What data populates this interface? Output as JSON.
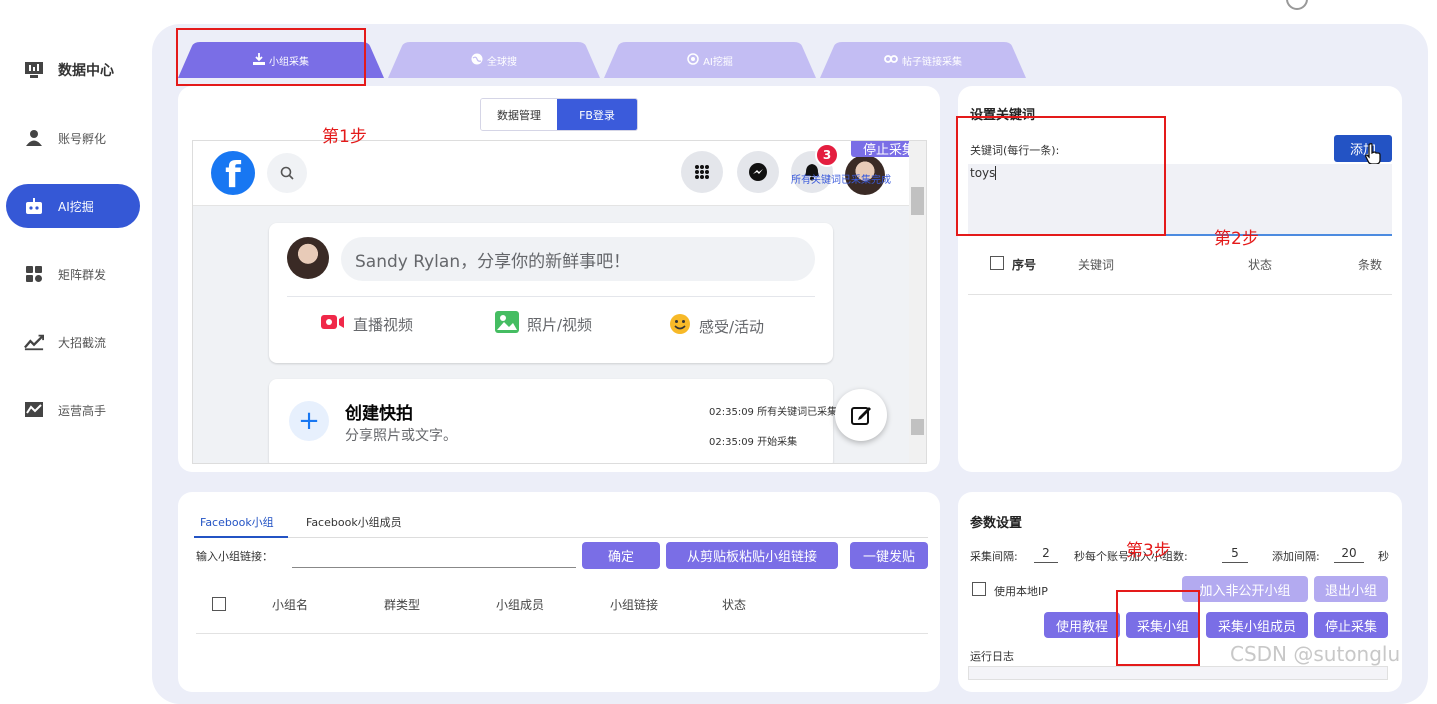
{
  "sidebar": {
    "items": [
      {
        "label": "数据中心",
        "icon": "data-center-icon"
      },
      {
        "label": "账号孵化",
        "icon": "user-icon"
      },
      {
        "label": "AI挖掘",
        "icon": "robot-icon"
      },
      {
        "label": "矩阵群发",
        "icon": "matrix-icon"
      },
      {
        "label": "大招截流",
        "icon": "trend-icon"
      },
      {
        "label": "运营高手",
        "icon": "chart-icon"
      }
    ]
  },
  "tabs": [
    {
      "label": "小组采集"
    },
    {
      "label": "全球搜"
    },
    {
      "label": "AI挖掘"
    },
    {
      "label": "帖子链接采集"
    }
  ],
  "browser": {
    "seg_buttons": [
      "数据管理",
      "FB登录"
    ],
    "stop_collect": "停止采集",
    "notif_count": "3",
    "overlay_status": "所有关键词已采集完成",
    "composer_placeholder": "Sandy Rylan，分享你的新鲜事吧！",
    "actions": [
      "直播视频",
      "照片/视频",
      "感受/活动"
    ],
    "story_title": "创建快拍",
    "story_sub": "分享照片或文字。",
    "log1": "02:35:09 所有关键词已采集完成",
    "log2": "02:35:09 开始采集"
  },
  "keywords": {
    "title": "设置关键词",
    "field_label": "关键词(每行一条):",
    "add_button": "添加",
    "value": "toys",
    "columns": [
      "序号",
      "关键词",
      "状态",
      "条数"
    ]
  },
  "groups": {
    "tabs": [
      "Facebook小组",
      "Facebook小组成员"
    ],
    "link_label": "输入小组链接：",
    "buttons": [
      "确定",
      "从剪贴板粘贴小组链接",
      "一键发贴"
    ],
    "columns": [
      "小组名",
      "群类型",
      "小组成员",
      "小组链接",
      "状态"
    ]
  },
  "params": {
    "title": "参数设置",
    "interval_label": "采集间隔:",
    "interval_value": "2",
    "per_account_label": "秒每个账号加入小组数:",
    "per_account_value": "5",
    "add_interval_label": "添加间隔:",
    "add_interval_value": "20",
    "sec": "秒",
    "use_local_ip": "使用本地IP",
    "join_private": "加入非公开小组",
    "exit_group": "退出小组",
    "tutorial": "使用教程",
    "collect_group": "采集小组",
    "collect_members": "采集小组成员",
    "stop_collect": "停止采集",
    "log_label": "运行日志"
  },
  "annotations": {
    "step1": "第1步",
    "step2": "第2步",
    "step3": "第3步"
  },
  "watermark": "CSDN @sutonglu",
  "colors": {
    "accent_purple": "#7a6ee6",
    "accent_blue": "#3558d6",
    "fb_blue": "#1877f2",
    "annotation_red": "#e41a1a"
  }
}
